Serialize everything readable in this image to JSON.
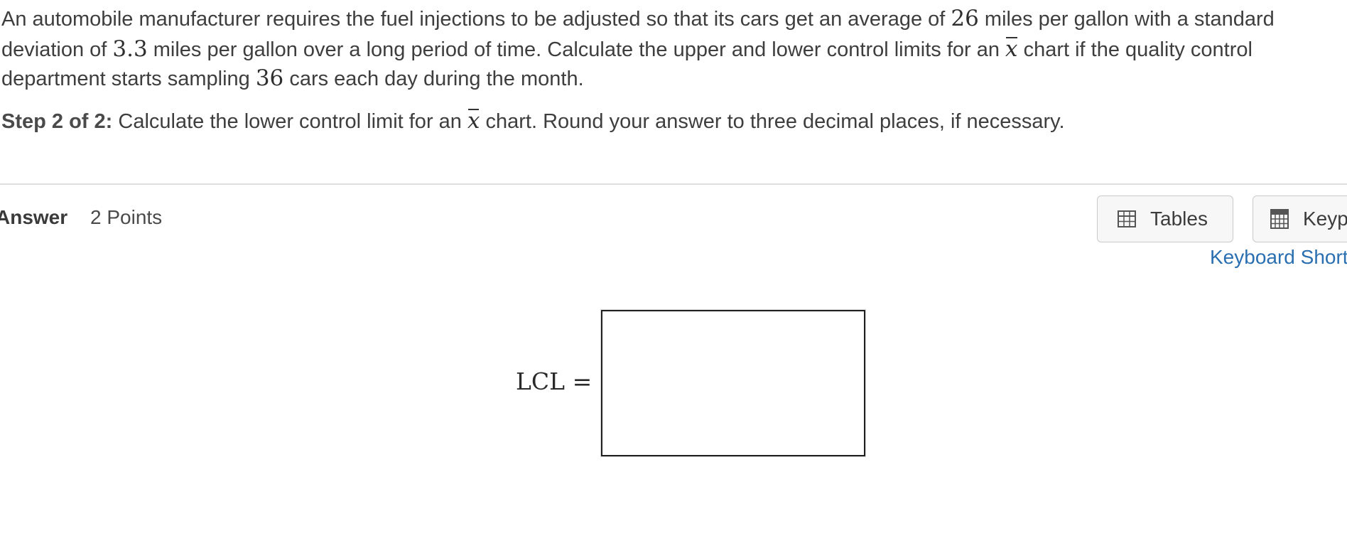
{
  "problem": {
    "text1": "An automobile manufacturer requires the fuel injections to be adjusted so that its cars get an average of ",
    "mean_value": "26",
    "text2": " miles per gallon with a standard deviation of ",
    "sd_value": "3.3",
    "text3": " miles per gallon over a long period of time. Calculate the upper and lower control limits for an ",
    "xbar_symbol": "x",
    "text4": " chart if the quality control department starts sampling ",
    "sample_value": "36",
    "text5": " cars each day during the month."
  },
  "step": {
    "label": "Step 2 of 2:",
    "text1": " Calculate the lower control limit for an ",
    "xbar_symbol": "x",
    "text2": " chart. Round your answer to three decimal places, if necessary."
  },
  "answer": {
    "label": "Answer",
    "points": "2 Points"
  },
  "toolbar": {
    "tables_label": "Tables",
    "keypad_label": "Keypad",
    "shortcuts_link": "Keyboard Shortcuts"
  },
  "input": {
    "lcl_label": "LCL =",
    "value": ""
  },
  "icons": {
    "tables": "table-grid-icon",
    "keypad": "calculator-icon"
  }
}
